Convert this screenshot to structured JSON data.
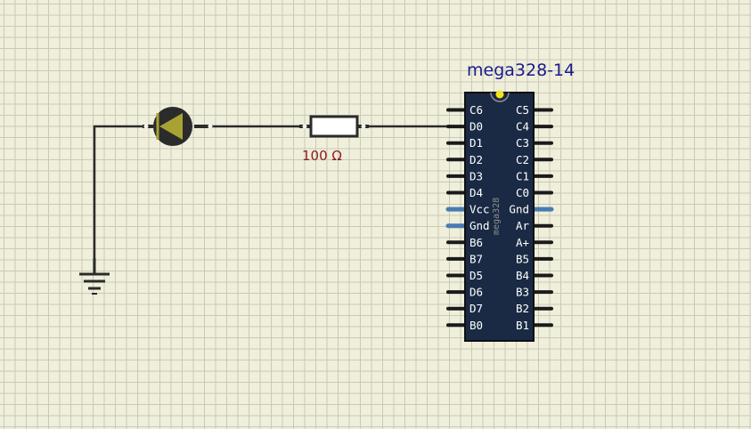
{
  "canvas": {
    "background": "#efefdc",
    "grid_color": "#c9c9b4"
  },
  "resistor": {
    "value_label": "100 Ω"
  },
  "led": {
    "color": "#a8a235"
  },
  "ground": {
    "icon": "ground-symbol-icon"
  },
  "chip": {
    "title": "mega328-14",
    "side_label": "mega328",
    "body_color": "#1a2a44",
    "power_pin_color": "#4a7ab0",
    "left_pins": [
      "C6",
      "D0",
      "D1",
      "D2",
      "D3",
      "D4",
      "Vcc",
      "Gnd",
      "B6",
      "B7",
      "D5",
      "D6",
      "D7",
      "B0"
    ],
    "right_pins": [
      "C5",
      "C4",
      "C3",
      "C2",
      "C1",
      "C0",
      "Gnd",
      "Ar",
      "A+",
      "B5",
      "B4",
      "B3",
      "B2",
      "B1"
    ]
  }
}
